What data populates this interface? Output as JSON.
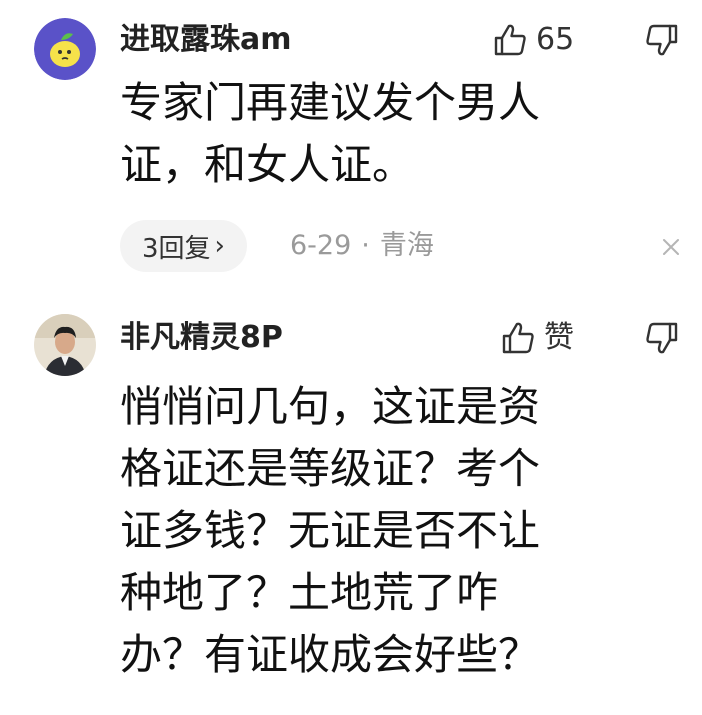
{
  "comments": [
    {
      "username": "进取露珠am",
      "like_label": "65",
      "body_lines": [
        "专家门再建议发个男人",
        "证，和女人证。"
      ],
      "reply_label": "3回复",
      "reply_chevron": "›",
      "date": "6-29",
      "separator": "·",
      "location": "青海",
      "avatar_color": "#5a52c8"
    },
    {
      "username": "非凡精灵8P",
      "like_label": "赞",
      "body_lines": [
        "悄悄问几句，这证是资",
        "格证还是等级证？考个",
        "证多钱？无证是否不让",
        "种地了？土地荒了咋",
        "办？有证收成会好些？"
      ]
    }
  ]
}
